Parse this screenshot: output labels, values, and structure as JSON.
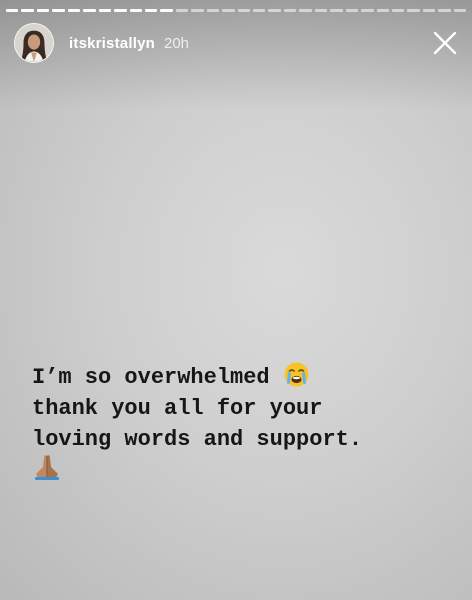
{
  "story": {
    "progress_segments": [
      {
        "filled": true
      },
      {
        "filled": true
      },
      {
        "filled": true
      },
      {
        "filled": true
      },
      {
        "filled": true
      },
      {
        "filled": true
      },
      {
        "filled": true
      },
      {
        "filled": true
      },
      {
        "filled": true
      },
      {
        "filled": true
      },
      {
        "filled": true
      },
      {
        "filled": false
      },
      {
        "filled": false
      },
      {
        "filled": false
      },
      {
        "filled": false
      },
      {
        "filled": false
      },
      {
        "filled": false
      },
      {
        "filled": false
      },
      {
        "filled": false
      },
      {
        "filled": false
      },
      {
        "filled": false
      },
      {
        "filled": false
      },
      {
        "filled": false
      },
      {
        "filled": false
      },
      {
        "filled": false
      },
      {
        "filled": false
      },
      {
        "filled": false
      },
      {
        "filled": false
      },
      {
        "filled": false
      },
      {
        "filled": false
      }
    ],
    "header": {
      "username": "itskristallyn",
      "timestamp": "20h",
      "avatar_icon": "profile-photo",
      "close_icon": "close-icon"
    },
    "caption": {
      "line1": "I’m so overwhelmed",
      "line2": "thank you all for your",
      "line3": "loving words and support.",
      "emoji1": "loudly-crying-face",
      "emoji2": "folded-hands"
    },
    "colors": {
      "background": "#cecece",
      "text": "#161616",
      "header_text": "#ffffff"
    }
  }
}
